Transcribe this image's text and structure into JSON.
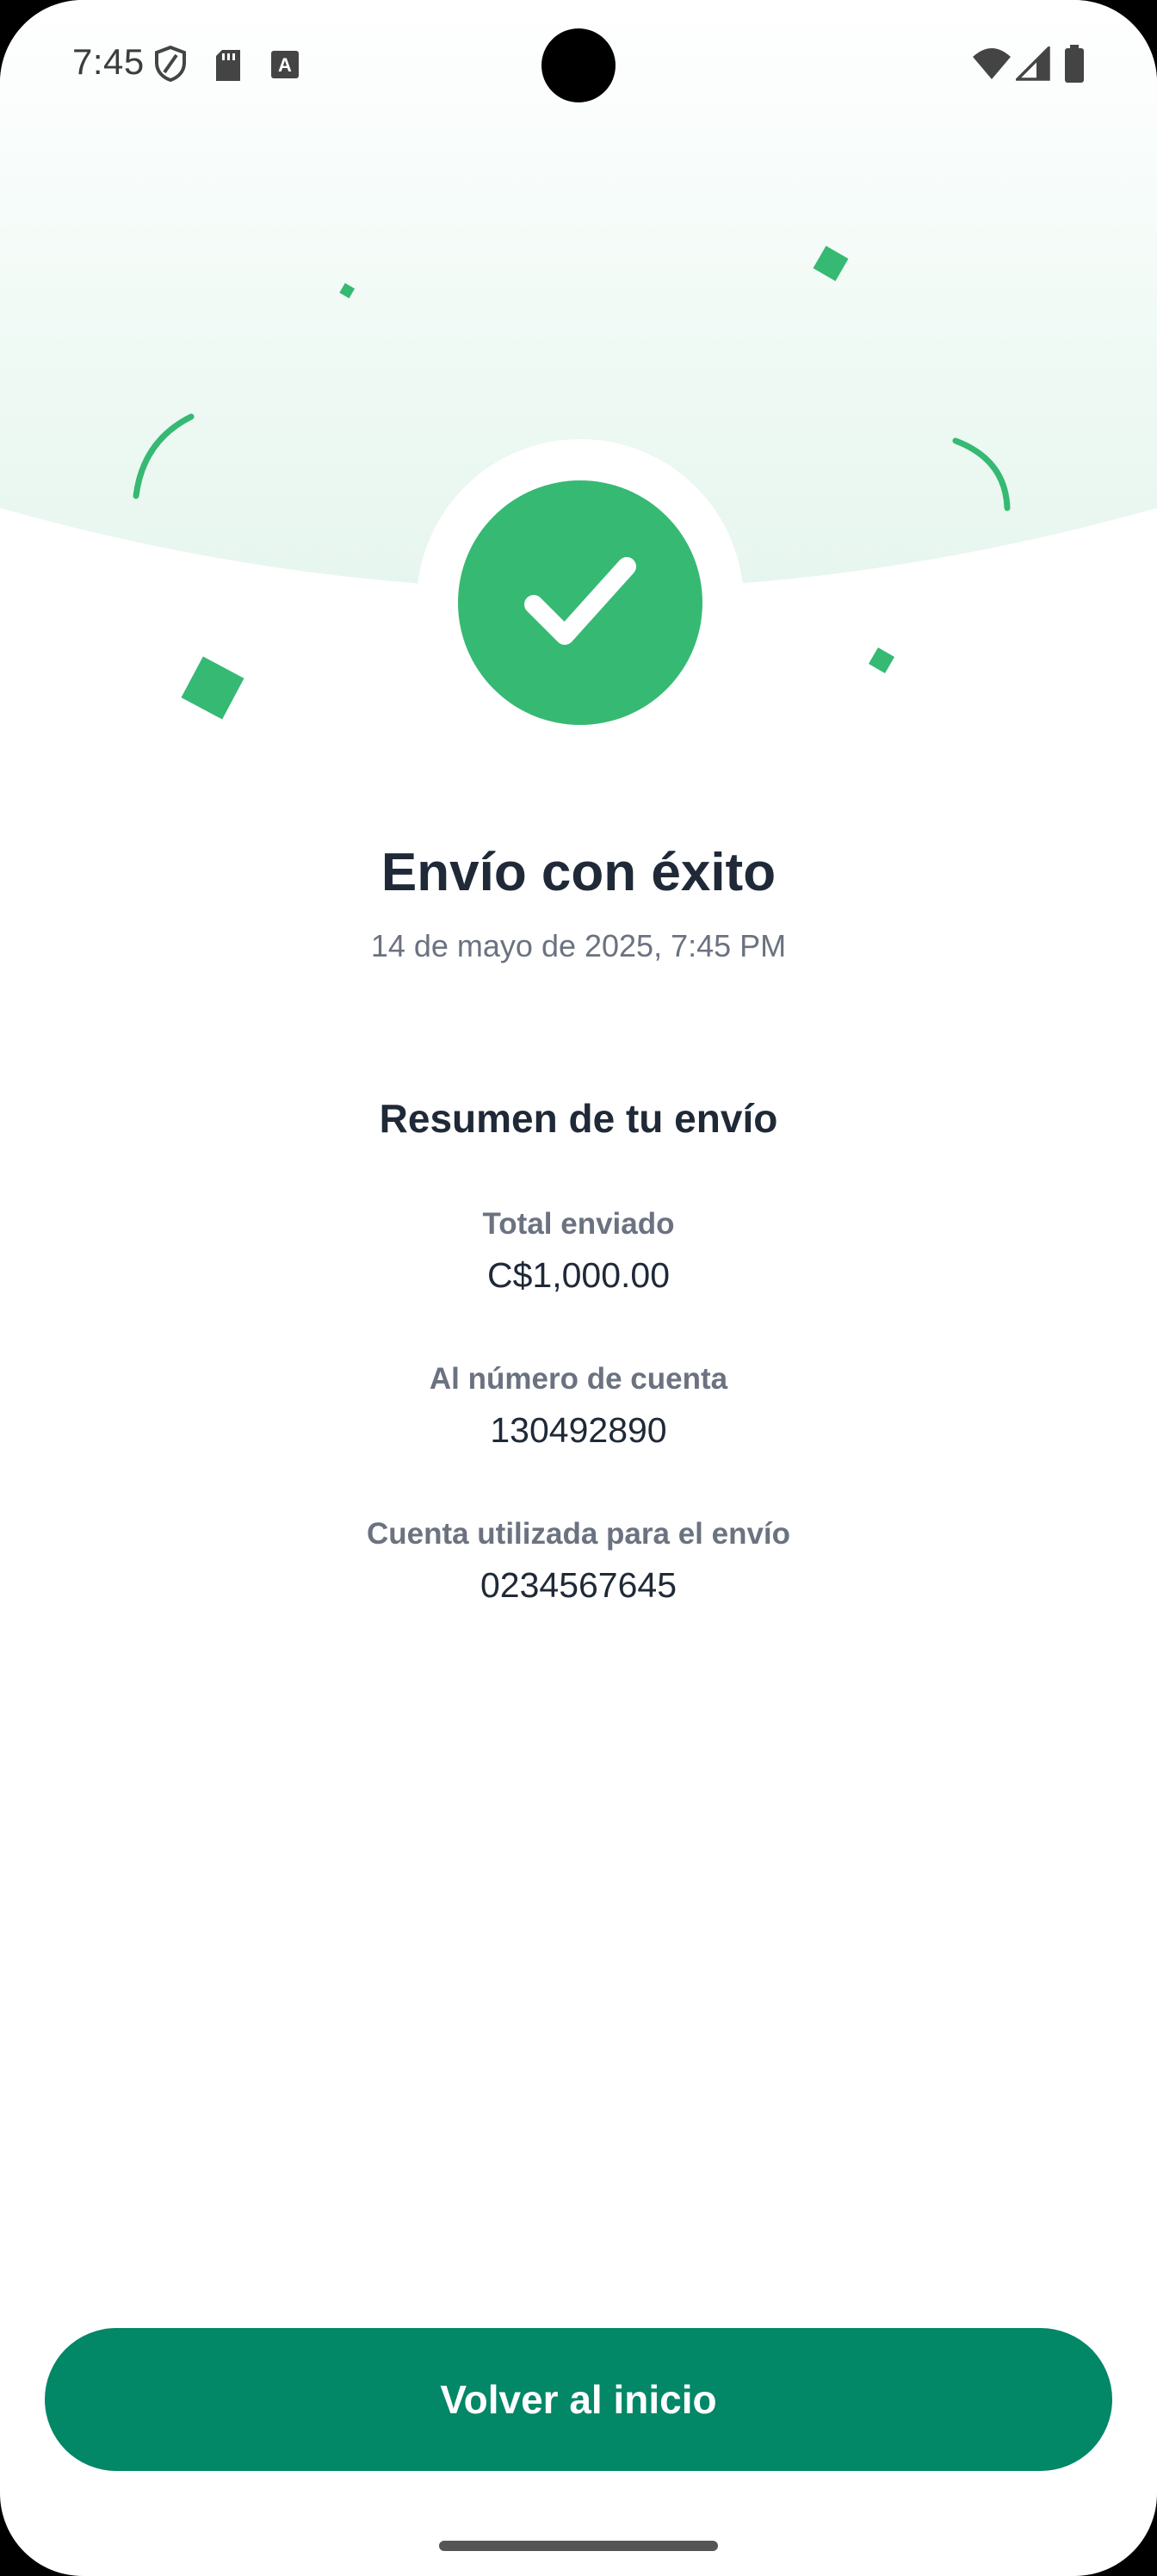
{
  "status_bar": {
    "time": "7:45",
    "left_icons": [
      "shield-icon",
      "sd-card-icon",
      "keyboard-a-icon"
    ],
    "right_icons": [
      "wifi-icon",
      "signal-icon",
      "battery-icon"
    ]
  },
  "colors": {
    "accent_green": "#36b973",
    "button_green": "#028767",
    "hero_tint": "#e6f6ee",
    "text_dark": "#1f2937",
    "text_muted": "#6b7280"
  },
  "success": {
    "icon": "check-icon",
    "title": "Envío con éxito",
    "date": "14 de mayo de 2025, 7:45 PM"
  },
  "summary": {
    "title": "Resumen de tu envío",
    "fields": [
      {
        "label": "Total enviado",
        "value": "C$1,000.00"
      },
      {
        "label": "Al número de cuenta",
        "value": "130492890"
      },
      {
        "label": "Cuenta utilizada para el envío",
        "value": "0234567645"
      }
    ]
  },
  "actions": {
    "home_button": "Volver al inicio"
  }
}
